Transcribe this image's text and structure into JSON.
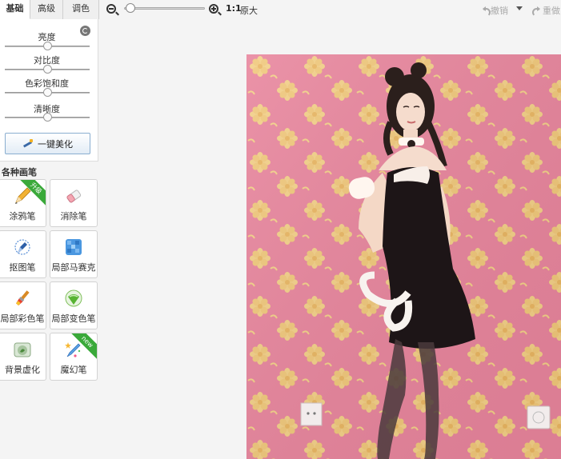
{
  "tabs": [
    {
      "label": "基础",
      "active": true
    },
    {
      "label": "高级",
      "active": false
    },
    {
      "label": "调色",
      "active": false
    }
  ],
  "adjustments": [
    {
      "label": "亮度",
      "level": 0.5
    },
    {
      "label": "对比度",
      "level": 0.5
    },
    {
      "label": "色彩饱和度",
      "level": 0.5
    },
    {
      "label": "清晰度",
      "level": 0.5
    }
  ],
  "beautify_button": "一键美化",
  "brushes_section_title": "各种画笔",
  "brushes": [
    {
      "label": "涂鸦笔",
      "icon": "pencil-icon",
      "badge": "升级"
    },
    {
      "label": "消除笔",
      "icon": "eraser-icon",
      "badge": ""
    },
    {
      "label": "抠图笔",
      "icon": "pen-nib-icon",
      "badge": ""
    },
    {
      "label": "局部马赛克",
      "icon": "mosaic-icon",
      "badge": ""
    },
    {
      "label": "局部彩色笔",
      "icon": "color-brush-icon",
      "badge": ""
    },
    {
      "label": "局部变色笔",
      "icon": "color-change-icon",
      "badge": ""
    },
    {
      "label": "背景虚化",
      "icon": "blur-icon",
      "badge": ""
    },
    {
      "label": "魔幻笔",
      "icon": "magic-pen-icon",
      "badge": "new"
    }
  ],
  "toolbar": {
    "zoom_level": 0.02,
    "actual_size_ratio": "1:1",
    "actual_size_label": "原大",
    "undo_label": "撤销",
    "redo_label": "重做"
  },
  "colors": {
    "wallpaper": "#e8849c",
    "flower": "#f3cf86",
    "badge_green": "#3aa93a",
    "button_border": "#8aaed0"
  }
}
